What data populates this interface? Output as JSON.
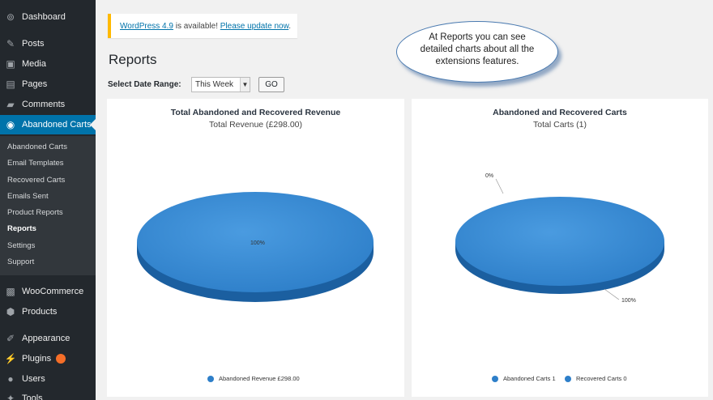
{
  "sidebar": {
    "items": [
      {
        "label": "Dashboard",
        "icon": "dashboard-icon",
        "glyph": "⊚"
      },
      {
        "label": "Posts",
        "icon": "pin-icon",
        "glyph": "✎"
      },
      {
        "label": "Media",
        "icon": "media-icon",
        "glyph": "▣"
      },
      {
        "label": "Pages",
        "icon": "pages-icon",
        "glyph": "▤"
      },
      {
        "label": "Comments",
        "icon": "comment-icon",
        "glyph": "▰"
      },
      {
        "label": "Abandoned Carts",
        "icon": "globe-icon",
        "glyph": "◉"
      }
    ],
    "submenu": [
      "Abandoned Carts",
      "Email Templates",
      "Recovered Carts",
      "Emails Sent",
      "Product Reports",
      "Reports",
      "Settings",
      "Support"
    ],
    "lower_items": [
      {
        "label": "WooCommerce",
        "icon": "woo-icon",
        "glyph": "▩"
      },
      {
        "label": "Products",
        "icon": "box-icon",
        "glyph": "⬢"
      },
      {
        "label": "Appearance",
        "icon": "brush-icon",
        "glyph": "✐"
      },
      {
        "label": "Plugins",
        "icon": "plug-icon",
        "glyph": "⚡"
      },
      {
        "label": "Users",
        "icon": "user-icon",
        "glyph": "●"
      },
      {
        "label": "Tools",
        "icon": "wrench-icon",
        "glyph": "✦"
      }
    ]
  },
  "notice": {
    "link": "WordPress 4.9",
    "text": " is available! ",
    "action": "Please update now",
    "end": "."
  },
  "page": {
    "title": "Reports",
    "range_label": "Select Date Range:",
    "range_value": "This Week",
    "go_label": "GO"
  },
  "callout": {
    "text": "At Reports you can see detailed charts about all the extensions features."
  },
  "chart_data": [
    {
      "type": "pie",
      "title": "Total Abandoned and Recovered Revenue",
      "subtitle": "Total Revenue (£298.00)",
      "slices": [
        {
          "label": "Abandoned Revenue £298.00",
          "value": 298.0,
          "percent_label": "100%"
        }
      ],
      "legend": "bottom"
    },
    {
      "type": "pie",
      "title": "Abandoned and Recovered Carts",
      "subtitle": "Total Carts (1)",
      "slices": [
        {
          "label": "Abandoned Carts 1",
          "value": 1,
          "percent_label": "100%"
        },
        {
          "label": "Recovered Carts 0",
          "value": 0,
          "percent_label": "0%"
        }
      ],
      "legend": "bottom"
    }
  ],
  "colors": {
    "accent": "#0073aa",
    "pie": "#2e7fc9",
    "pie_side": "#1b5fa0",
    "notice": "#ffb900",
    "badge": "#f56e28"
  }
}
